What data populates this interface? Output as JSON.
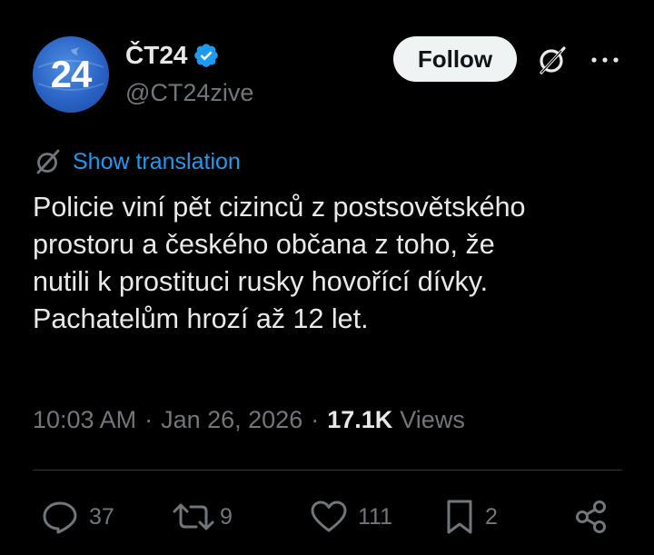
{
  "account": {
    "avatar_text": "24",
    "display_name": "ČT24",
    "handle": "@CT24zive",
    "verified": true
  },
  "header": {
    "follow_label": "Follow"
  },
  "tweet": {
    "translate_label": "Show translation",
    "text": "Policie viní pět cizinců z postsovětského\nprostoru a českého občana z toho, že\nnutili k prostituci rusky hovořící dívky.\nPachatelům hrozí až 12 let.",
    "time": "10:03 AM",
    "separator": "·",
    "date": "Jan 26, 2026",
    "views_count": "17.1K",
    "views_label": "Views"
  },
  "actions": {
    "replies": "37",
    "reposts": "9",
    "likes": "111",
    "bookmarks": "2"
  },
  "colors": {
    "background": "#000000",
    "text": "#e7e9ea",
    "secondary": "#71767b",
    "accent": "#1d9bf0",
    "button_bg": "#eff3f4"
  },
  "icons": {
    "verified": "verified-badge-icon",
    "grok": "grok-icon",
    "more": "more-dots-icon",
    "translate": "grok-translate-icon",
    "reply": "reply-icon",
    "repost": "repost-icon",
    "like": "heart-icon",
    "bookmark": "bookmark-icon",
    "share": "share-icon"
  }
}
